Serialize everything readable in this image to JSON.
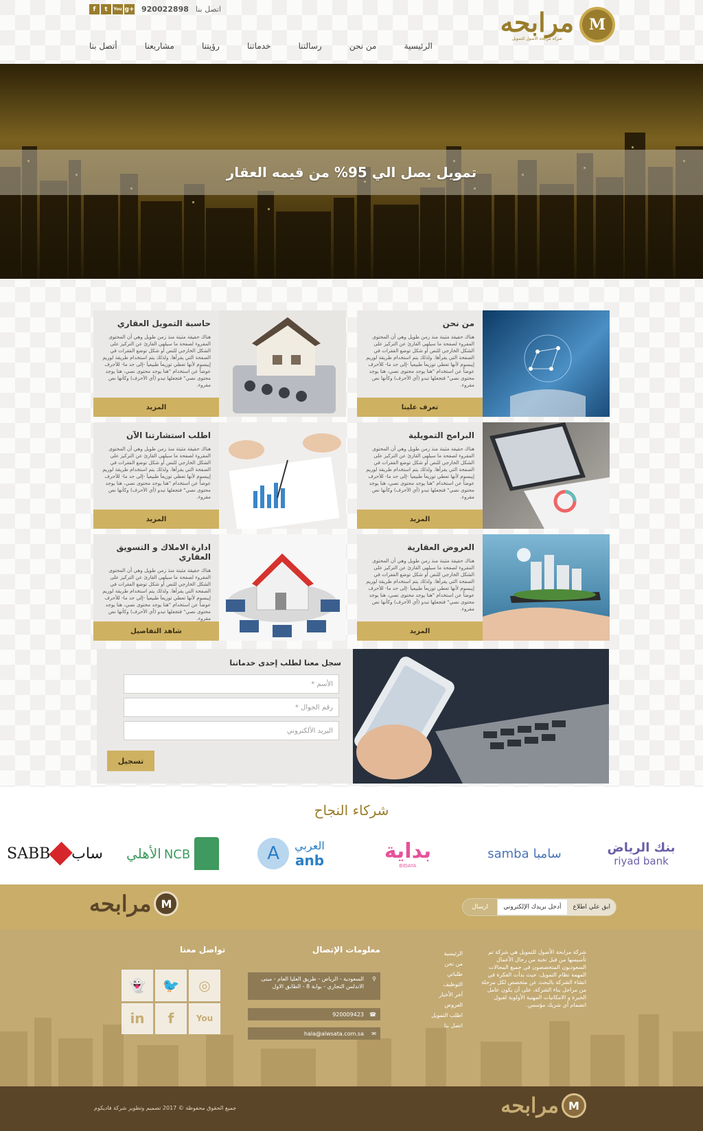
{
  "header": {
    "logo_text": "مرابحه",
    "logo_mark": "M",
    "logo_tagline": "شركة مرابحة الأصول للتمويل",
    "contact_label": "اتصل بنا",
    "phone": "920022898",
    "social": [
      {
        "icon": "googleplus-icon",
        "glyph": "g+"
      },
      {
        "icon": "youtube-icon",
        "glyph": "You"
      },
      {
        "icon": "twitter-icon",
        "glyph": "t"
      },
      {
        "icon": "facebook-icon",
        "glyph": "f"
      }
    ],
    "nav": [
      "الرئيسية",
      "من نحن",
      "رسالتنا",
      "خدماتنا",
      "رؤيتنا",
      "مشاريعنا",
      "أتصل بنا"
    ]
  },
  "hero": {
    "headline": "تمويل يصل الي 95% من قيمه العقار"
  },
  "cards": [
    {
      "title": "من نحن",
      "button": "تعرف علينا"
    },
    {
      "title": "حاسبة التمويل العقاري",
      "button": "المزيد"
    },
    {
      "title": "البرامج التمويلية",
      "button": "المزيد"
    },
    {
      "title": "اطلب استشارتنا الآن",
      "button": "المزيد"
    },
    {
      "title": "العروض العقارية",
      "button": "المزيد"
    },
    {
      "title": "ادارة الاملاك و التسويق العقاري",
      "button": "شاهد التفاصيل"
    }
  ],
  "card_body_text": "هناك حقيقة مثبتة منذ زمن طويل وهي أن المحتوى المقروء لصفحة ما سيلهي القارئ عن التركيز على الشكل الخارجي للنص أو شكل توضع الفقرات في الصفحة التي يقرأها. ولذلك يتم استخدام طريقة لوريم إيبسوم لأنها تعطي توزيعاَ طبيعياَ -إلى حد ما- للأحرف عوضاً عن استخدام \"هنا يوجد محتوى نصي، هنا يوجد محتوى نصي\" فتجعلها تبدو (أي الأحرف) وكأنها نص مقروء.",
  "form": {
    "title": "سجل معنا لطلب إحدى خدماتنا",
    "name_placeholder": "الأسم *",
    "mobile_placeholder": "رقم الجوال *",
    "email_placeholder": "البريد الألكتروني",
    "submit": "تسجيل"
  },
  "partners": {
    "title": "شركاء النجاح",
    "items": [
      {
        "name": "riyad bank",
        "ar": "بنك الرياض",
        "color": "#6b5fa8"
      },
      {
        "name": "samba",
        "ar": "سامبا",
        "color": "#4a73b8"
      },
      {
        "name": "BIDAYA",
        "ar": "بداية",
        "color": "#e7529a"
      },
      {
        "name": "anb",
        "ar": "العربي",
        "color": "#2b7fc4"
      },
      {
        "name": "NCB",
        "ar": "الأهلي",
        "color": "#3f9a5f"
      },
      {
        "name": "SABB",
        "ar": "ساب",
        "color": "#1b1b1b"
      }
    ]
  },
  "newsletter": {
    "label": "ابق علي اطلاع",
    "input_value": "أدخل بريدك الإلكتروني",
    "send": "ارسال"
  },
  "footer": {
    "about": "شركة مرابحة الأصول للتمويل هي شركة تم تأسيسها من قبل نخبة من رجال الأعمال السعوديون المتخصصون في جميع المجالات المهمة نظام التمويل، حيث بدأت الفكرة في انشاء الشركة بالبحث عن متخصص لكل مرحلة من مراحل بناء الشركة، على أن يكون عامل الخبرة و الامكانيات المهنية الأولوية لقبول انضمام أي شريك مؤسس.",
    "links": [
      "الرئيسية",
      "من نحن",
      "طلباتي",
      "التوظيف",
      "آخر الأخبار",
      "العروض",
      "اطلب التمويل",
      "اتصل بنا"
    ],
    "contact_title": "معلومات الإتصال",
    "address": "السعودية - الرياض - طريق العليا العام - مبنى الاندلس التجاري - بوابة 8 - الطابق الاول",
    "phone": "920009423",
    "email": "hala@alwsata.com.sa",
    "social_title": "تواصل معنا",
    "social": [
      {
        "icon": "instagram-icon",
        "glyph": "◎"
      },
      {
        "icon": "twitter-icon",
        "glyph": "🐦"
      },
      {
        "icon": "snapchat-icon",
        "glyph": "👻"
      },
      {
        "icon": "youtube-icon",
        "glyph": "You"
      },
      {
        "icon": "facebook-icon",
        "glyph": "f"
      },
      {
        "icon": "linkedin-icon",
        "glyph": "in"
      }
    ],
    "copyright": "جميع الحقوق محفوظة © 2017 تصميم وتطوير شركة فاديكوم"
  },
  "colors": {
    "gold": "#cfb162",
    "gold_dark": "#9a7d2c",
    "footer": "#c3aa73",
    "bottom": "#5b4529"
  }
}
